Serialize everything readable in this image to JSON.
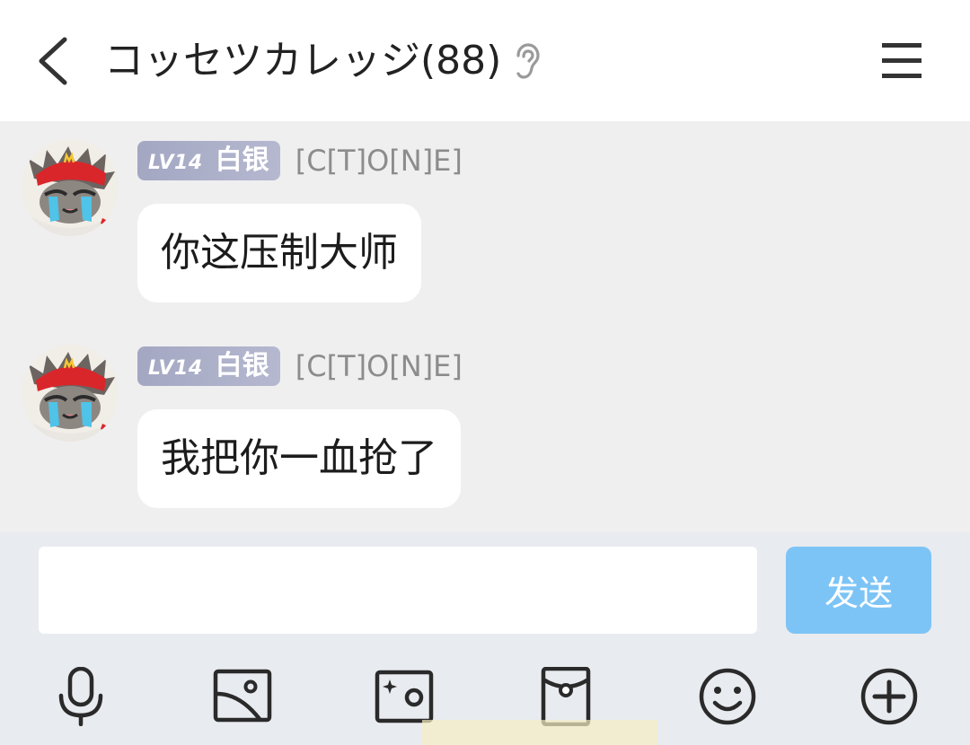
{
  "header": {
    "title": "コッセツカレッジ(88)",
    "back_icon": "chevron-left-icon",
    "ear_icon": "ear-icon",
    "menu_icon": "hamburger-menu-icon"
  },
  "messages": [
    {
      "sender": "[C[T]O[N]E]",
      "level": "LV14",
      "rank": "白银",
      "text": "你这压制大师"
    },
    {
      "sender": "[C[T]O[N]E]",
      "level": "LV14",
      "rank": "白银",
      "text": "我把你一血抢了"
    }
  ],
  "composer": {
    "input_value": "",
    "send_label": "发送"
  },
  "toolbar": [
    {
      "icon": "microphone-icon"
    },
    {
      "icon": "image-icon"
    },
    {
      "icon": "camera-icon"
    },
    {
      "icon": "red-envelope-icon"
    },
    {
      "icon": "emoji-icon"
    },
    {
      "icon": "plus-circle-icon"
    }
  ],
  "colors": {
    "chat_background": "#efeff0",
    "send_button": "#7dc4f6",
    "level_badge": "#a3a7c2",
    "avatar_cap_red": "#d9262a",
    "avatar_tears": "#4fc3e8"
  }
}
